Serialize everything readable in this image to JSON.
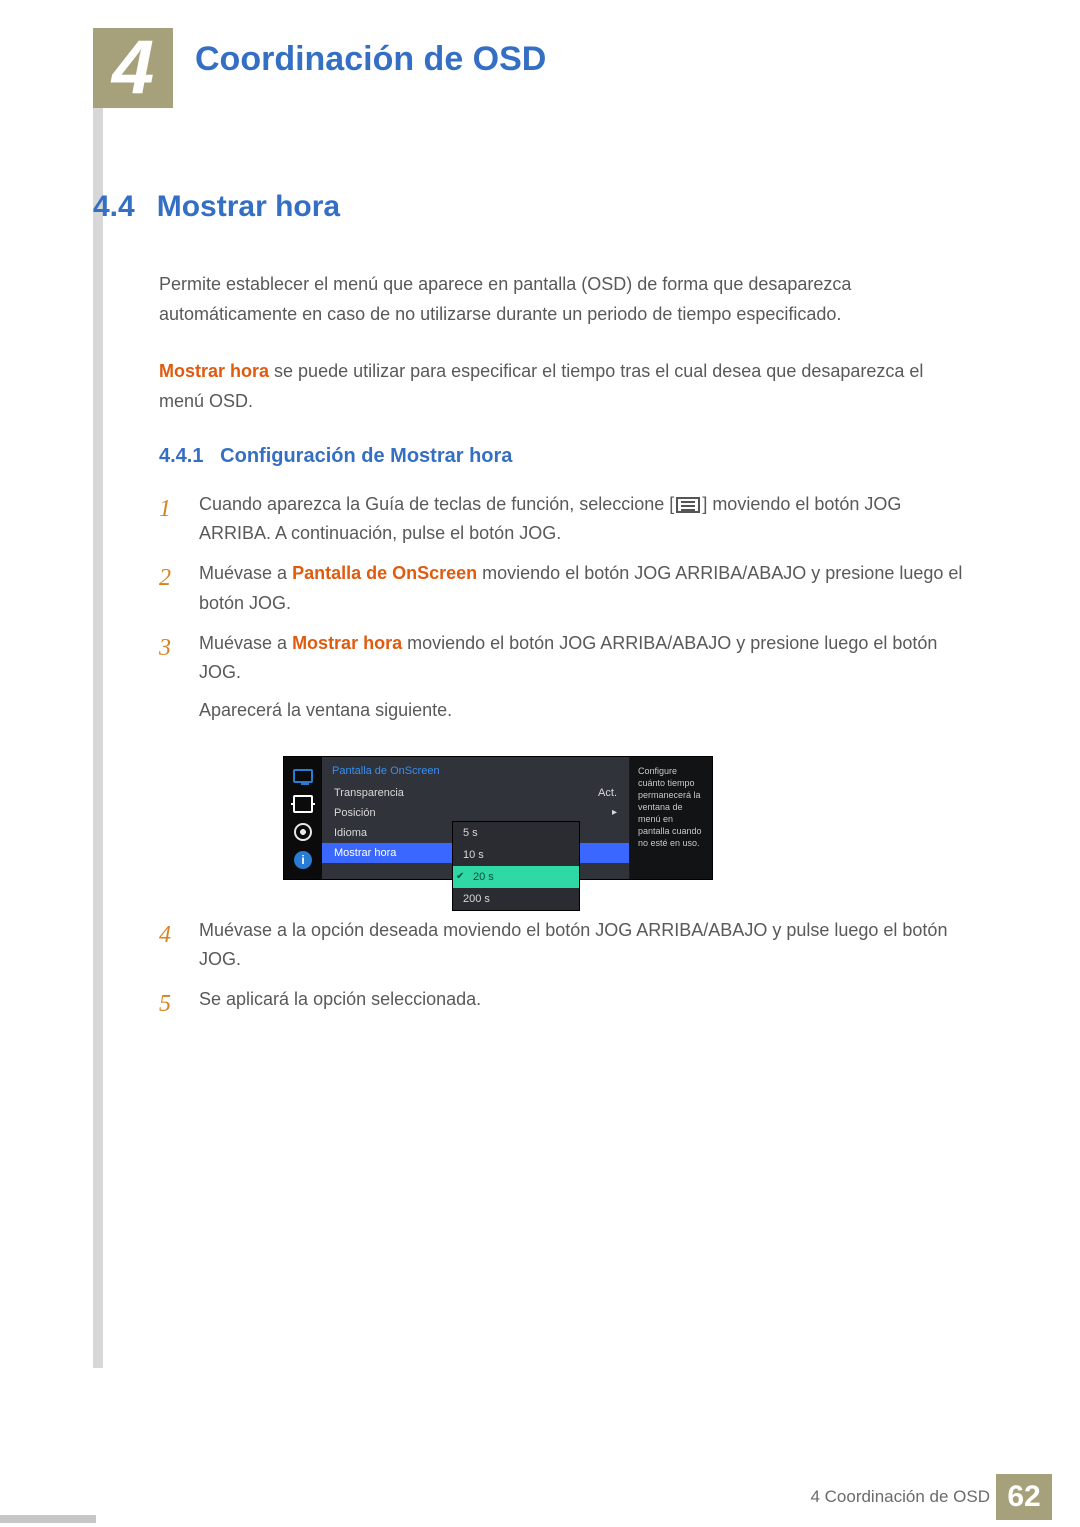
{
  "chapter": {
    "number": "4",
    "title": "Coordinación de OSD"
  },
  "section": {
    "number": "4.4",
    "title": "Mostrar hora"
  },
  "intro1": "Permite establecer el menú que aparece en pantalla (OSD) de forma que desaparezca automáticamente en caso de no utilizarse durante un periodo de tiempo especificado.",
  "intro2_pre": "Mostrar hora",
  "intro2_rest": " se puede utilizar para especificar el tiempo tras el cual desea que desaparezca el menú OSD.",
  "subsection": {
    "number": "4.4.1",
    "title": "Configuración de Mostrar hora"
  },
  "steps": {
    "s1_pre": "Cuando aparezca la Guía de teclas de función, seleccione [",
    "s1_post": "] moviendo el botón JOG ARRIBA. A continuación, pulse el botón JOG.",
    "s2_pre": "Muévase a ",
    "s2_em": "Pantalla de OnScreen",
    "s2_post": " moviendo el botón JOG ARRIBA/ABAJO y presione luego el botón JOG.",
    "s3_pre": "Muévase a ",
    "s3_em": "Mostrar hora",
    "s3_post": " moviendo el botón JOG ARRIBA/ABAJO y presione luego el botón JOG.",
    "s3_tail": "Aparecerá la ventana siguiente.",
    "s4": "Muévase a la opción deseada moviendo el botón JOG ARRIBA/ABAJO y pulse luego el botón JOG.",
    "s5": "Se aplicará la opción seleccionada."
  },
  "osd": {
    "header": "Pantalla de OnScreen",
    "rows": [
      {
        "label": "Transparencia",
        "value": "Act."
      },
      {
        "label": "Posición",
        "value": "▸"
      },
      {
        "label": "Idioma",
        "value": ""
      },
      {
        "label": "Mostrar hora",
        "value": ""
      }
    ],
    "options": [
      "5 s",
      "10 s",
      "20 s",
      "200 s"
    ],
    "selected_option": "20 s",
    "help": "Configure cuánto tiempo permanecerá la ventana de menú en pantalla cuando no esté en uso."
  },
  "footer": {
    "label": "4 Coordinación de OSD",
    "page": "62"
  }
}
